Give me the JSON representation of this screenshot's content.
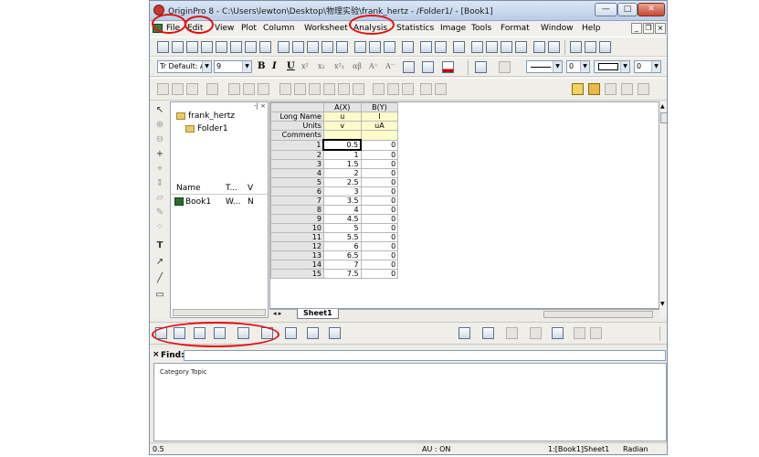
{
  "window": {
    "title": "OriginPro 8 - C:\\Users\\lewton\\Desktop\\物理实验\\frank_hertz - /Folder1/ - [Book1]",
    "minimize": "—",
    "maximize": "□",
    "close": "✕"
  },
  "menu": [
    "File",
    "Edit",
    "View",
    "Plot",
    "Column",
    "Worksheet",
    "Analysis",
    "Statistics",
    "Image",
    "Tools",
    "Format",
    "Window",
    "Help"
  ],
  "mdi_controls": {
    "minimize": "_",
    "restore": "❐",
    "close": "×"
  },
  "format_toolbar": {
    "font": "Tr Default: A",
    "size": "9",
    "bold": "B",
    "italic": "I",
    "underline": "U",
    "sup": "x²",
    "sub": "x₂",
    "supsub": "x²₁",
    "greek": "αβ",
    "larger": "A⁺",
    "smaller": "A⁻",
    "line_width": "0",
    "pattern_width": "0"
  },
  "project_explorer": {
    "root": "frank_hertz",
    "folder": "Folder1",
    "columns": [
      "Name",
      "T...",
      "V"
    ],
    "items": [
      {
        "name": "Book1",
        "t": "W...",
        "v": "N"
      }
    ]
  },
  "worksheet": {
    "col_headers": [
      "A(X)",
      "B(Y)"
    ],
    "label_rows": [
      {
        "label": "Long Name",
        "values": [
          "u",
          "I"
        ]
      },
      {
        "label": "Units",
        "values": [
          "v",
          "uA"
        ]
      },
      {
        "label": "Comments",
        "values": [
          "",
          ""
        ]
      }
    ],
    "rows": [
      {
        "n": "1",
        "a": "0.5",
        "b": "0"
      },
      {
        "n": "2",
        "a": "1",
        "b": "0"
      },
      {
        "n": "3",
        "a": "1.5",
        "b": "0"
      },
      {
        "n": "4",
        "a": "2",
        "b": "0"
      },
      {
        "n": "5",
        "a": "2.5",
        "b": "0"
      },
      {
        "n": "6",
        "a": "3",
        "b": "0"
      },
      {
        "n": "7",
        "a": "3.5",
        "b": "0"
      },
      {
        "n": "8",
        "a": "4",
        "b": "0"
      },
      {
        "n": "9",
        "a": "4.5",
        "b": "0"
      },
      {
        "n": "10",
        "a": "5",
        "b": "0"
      },
      {
        "n": "11",
        "a": "5.5",
        "b": "0"
      },
      {
        "n": "12",
        "a": "6",
        "b": "0"
      },
      {
        "n": "13",
        "a": "6.5",
        "b": "0"
      },
      {
        "n": "14",
        "a": "7",
        "b": "0"
      },
      {
        "n": "15",
        "a": "7.5",
        "b": "0"
      }
    ],
    "sheet_tab": "Sheet1"
  },
  "find": {
    "label": "Find:",
    "value": "",
    "headers": [
      "Category",
      "Topic"
    ]
  },
  "status": {
    "left": "0.5",
    "au": "AU : ON",
    "sheet": "1:[Book1]Sheet1",
    "angle": "Radian"
  },
  "colors": {
    "highlight_marks": "#e01010",
    "label_rows": "#fffbcb"
  }
}
